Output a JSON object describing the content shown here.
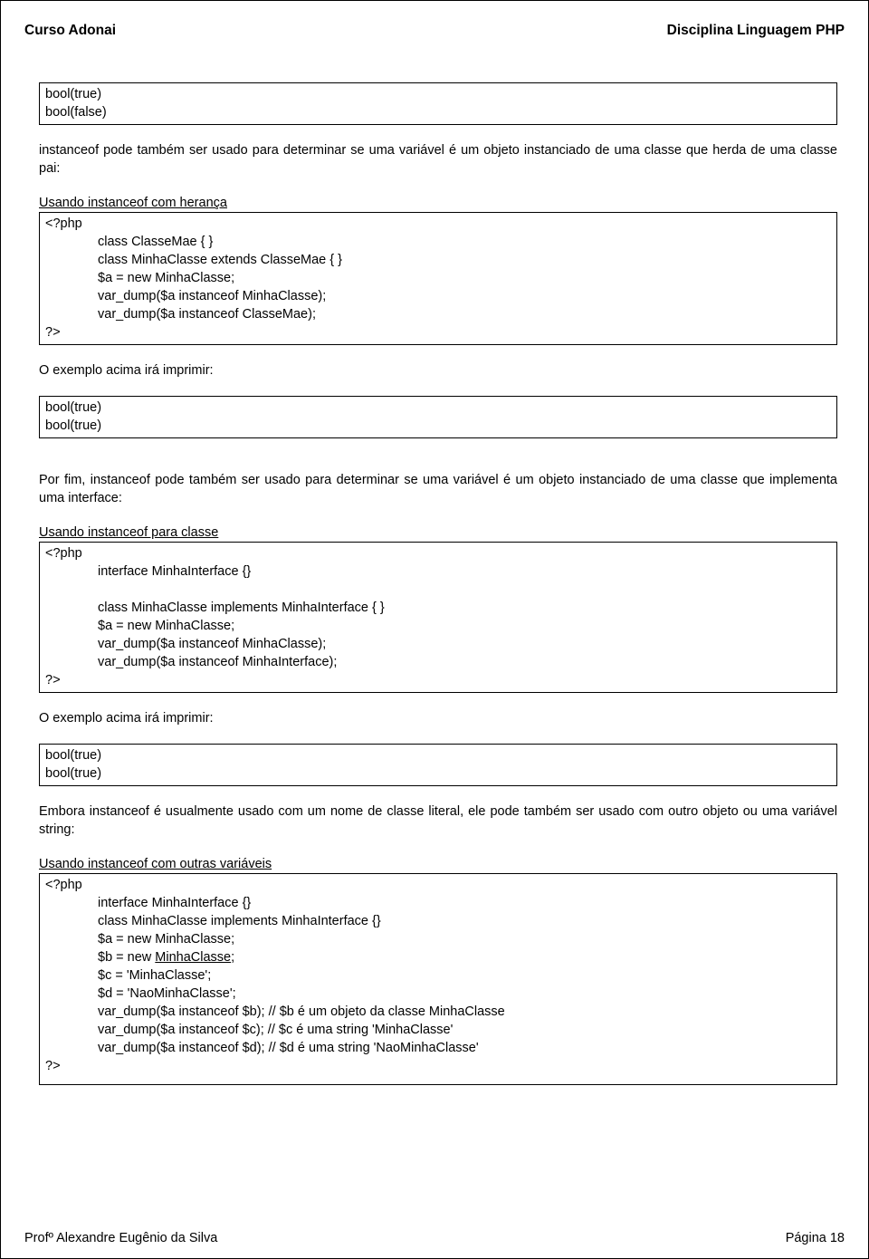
{
  "header": {
    "left": "Curso Adonai",
    "right": "Disciplina Linguagem PHP"
  },
  "box1": {
    "l1": "bool(true)",
    "l2": "bool(false)"
  },
  "para1": "instanceof pode também ser usado para determinar se uma variável é um objeto instanciado de uma classe que herda de uma classe pai:",
  "title1": "Usando instanceof com herança",
  "code1": {
    "open": "<?php",
    "l1": "class ClasseMae { }",
    "l2": "class MinhaClasse extends ClasseMae { }",
    "l3": "$a = new MinhaClasse;",
    "l4": "var_dump($a instanceof MinhaClasse);",
    "l5": "var_dump($a instanceof ClasseMae);",
    "close": "?>"
  },
  "outlabel": "O exemplo acima irá imprimir:",
  "box2": {
    "l1": "bool(true)",
    "l2": "bool(true)"
  },
  "para2": "Por fim, instanceof pode também ser usado para determinar se uma variável é um objeto instanciado de uma classe que implementa uma interface:",
  "title2": "Usando instanceof para classe",
  "code2": {
    "open": "<?php",
    "l1": "interface MinhaInterface {}",
    "l2": "class MinhaClasse implements MinhaInterface { }",
    "l3": "$a = new MinhaClasse;",
    "l4": "var_dump($a instanceof MinhaClasse);",
    "l5": "var_dump($a instanceof MinhaInterface);",
    "close": "?>"
  },
  "box3": {
    "l1": "bool(true)",
    "l2": "bool(true)"
  },
  "para3": "Embora instanceof é usualmente usado com um nome de classe literal, ele pode também ser usado com outro objeto ou uma variável string:",
  "title3": "Usando instanceof com outras variáveis",
  "code3": {
    "open": "<?php",
    "l1": "interface MinhaInterface {}",
    "l2": "class MinhaClasse implements MinhaInterface {}",
    "l3": "$a = new MinhaClasse;",
    "l4a": "$b = new ",
    "l4b": "MinhaClasse",
    "l4c": ";",
    "l5": "$c = 'MinhaClasse';",
    "l6": "$d = 'NaoMinhaClasse';",
    "l7": "var_dump($a instanceof $b); // $b é um objeto da classe MinhaClasse",
    "l8": "var_dump($a instanceof $c); // $c é uma string 'MinhaClasse'",
    "l9": "var_dump($a instanceof $d); // $d é uma string 'NaoMinhaClasse'",
    "close": "?>"
  },
  "footer": {
    "left": "Profº Alexandre Eugênio da Silva",
    "right": "Página 18"
  }
}
